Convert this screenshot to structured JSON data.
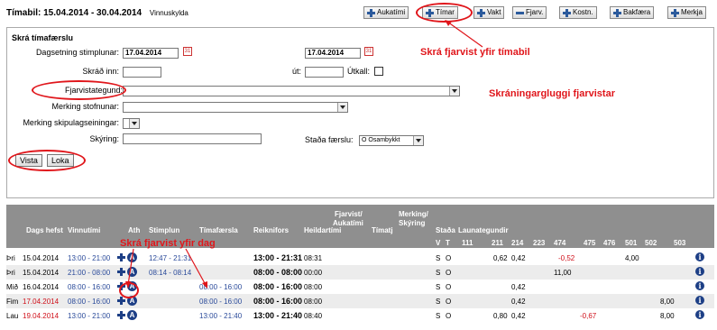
{
  "header": {
    "title": "Tímabil: 15.04.2014 - 30.04.2014",
    "subtitle": "Vinnuskylda"
  },
  "toolbar": [
    {
      "label": "Aukatími",
      "icon": "plus-icon"
    },
    {
      "label": "Tímar",
      "icon": "plus-icon"
    },
    {
      "label": "Vakt",
      "icon": "plus-icon"
    },
    {
      "label": "Fjarv.",
      "icon": "minus-icon"
    },
    {
      "label": "Kostn.",
      "icon": "plus-icon"
    },
    {
      "label": "Bakfæra",
      "icon": "plus-icon"
    },
    {
      "label": "Merkja",
      "icon": "plus-icon"
    }
  ],
  "form": {
    "heading": "Skrá tímafærslu",
    "date_label": "Dagsetning stimplunar:",
    "date_from": "17.04.2014",
    "date_to": "17.04.2014",
    "in_label": "Skráð inn:",
    "out_label": "út:",
    "checkout_label": "Útkall:",
    "absence_label": "Fjarvistategund:",
    "org_label": "Merking stofnunar:",
    "unit_label": "Merking skipulagseiningar:",
    "note_label": "Skýring:",
    "status_label": "Staða færslu:",
    "status_value": "O Osambykkt",
    "show_button": "Vista",
    "close_button": "Loka"
  },
  "annotations": {
    "period": "Skrá fjarvist yfir tímabil",
    "window": "Skráningargluggi fjarvistar",
    "day": "Skrá fjarvist yfir dag"
  },
  "table": {
    "headers": {
      "date": "Dags hefst",
      "worktime": "Vinnutími",
      "ath": "Ath",
      "stamp": "Stimplun",
      "entry": "Tímafærsla",
      "calc": "Reiknifors",
      "total": "Heildartími",
      "absence1": "Fjarvist/",
      "absence2": "Aukatími",
      "time": "Tímatj",
      "mark1": "Merking/",
      "mark2": "Skýring",
      "status": "Staða",
      "codes": "Launategundir",
      "v": "V",
      "t": "T",
      "c111": "111",
      "c211": "211",
      "c214": "214",
      "c223": "223",
      "c474": "474",
      "c475": "475",
      "c476": "476",
      "c501": "501",
      "c502": "502",
      "c503": "503"
    },
    "rows": [
      {
        "day": "Þri",
        "date": "15.04.2014",
        "worktime": "13:00 - 21:00",
        "stamp": "12:47 - 21:31",
        "entry": "",
        "calc": "13:00 - 21:31",
        "total": "08:31",
        "v": "S",
        "t": "O",
        "c211": "0,62",
        "c214": "0,42",
        "c474": "-0,52",
        "c501": "4,00",
        "c502": "",
        "red_date": false
      },
      {
        "day": "Þri",
        "date": "15.04.2014",
        "worktime": "21:00 - 08:00",
        "stamp": "08:14 - 08:14",
        "entry": "",
        "calc": "08:00 - 08:00",
        "total": "00:00",
        "v": "S",
        "t": "O",
        "c211": "",
        "c214": "",
        "c474": "11,00",
        "c501": "",
        "c502": "",
        "red_date": false
      },
      {
        "day": "Mið",
        "date": "16.04.2014",
        "worktime": "08:00 - 16:00",
        "stamp": "",
        "entry": "08:00 - 16:00",
        "calc": "08:00 - 16:00",
        "total": "08:00",
        "v": "S",
        "t": "O",
        "c211": "",
        "c214": "0,42",
        "c474": "",
        "c501": "",
        "c502": "",
        "red_date": false
      },
      {
        "day": "Fim",
        "date": "17.04.2014",
        "worktime": "08:00 - 16:00",
        "stamp": "",
        "entry": "08:00 - 16:00",
        "calc": "08:00 - 16:00",
        "total": "08:00",
        "v": "S",
        "t": "O",
        "c211": "",
        "c214": "0,42",
        "c474": "",
        "c501": "",
        "c502": "8,00",
        "red_date": true
      },
      {
        "day": "Lau",
        "date": "19.04.2014",
        "worktime": "13:00 - 21:00",
        "stamp": "",
        "entry": "13:00 - 21:40",
        "calc": "13:00 - 21:40",
        "total": "08:40",
        "v": "S",
        "t": "O",
        "c211": "0,80",
        "c214": "0,42",
        "c474": "-0,67",
        "c501": "",
        "c502": "8,00",
        "red_date": true
      }
    ]
  },
  "colors": {
    "annotation": "#e0161b",
    "header_bg": "#8f8f8f",
    "link_blue": "#2a4a9a"
  }
}
